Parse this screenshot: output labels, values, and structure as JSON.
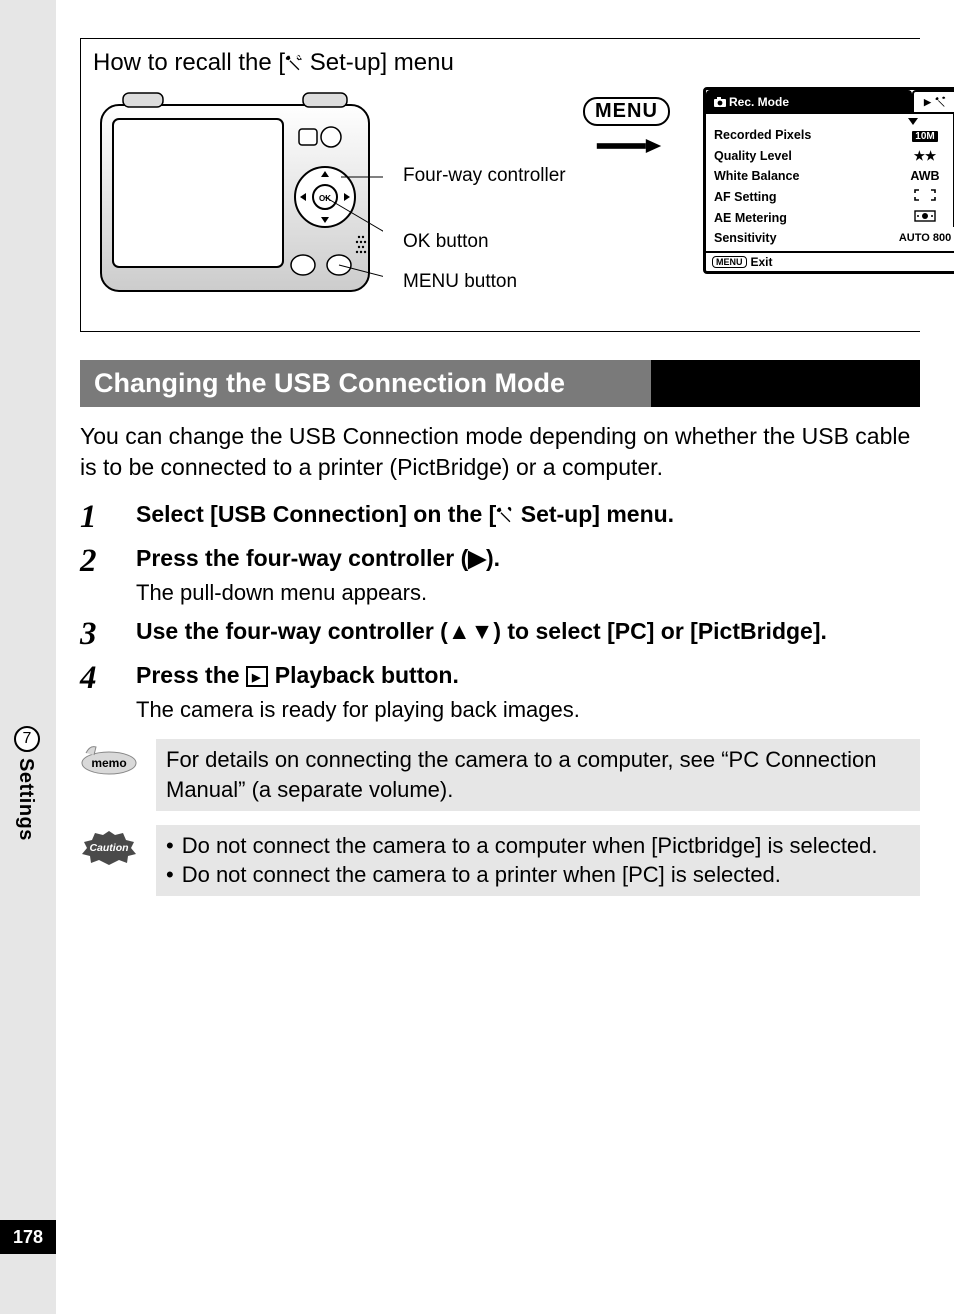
{
  "page_number": "178",
  "tab": {
    "number": "7",
    "label": "Settings"
  },
  "recall": {
    "title_pre": "How to recall the [",
    "title_post": " Set-up] menu",
    "labels": {
      "fourway": "Four-way controller",
      "ok": "OK button",
      "menu": "MENU button"
    },
    "menu_button_label": "MENU"
  },
  "menu_screen": {
    "active_tab_label": "Rec. Mode",
    "rows": [
      {
        "label": "Recorded Pixels",
        "value_type": "px",
        "value": "10M"
      },
      {
        "label": "Quality Level",
        "value_type": "stars",
        "value": "★★"
      },
      {
        "label": "White Balance",
        "value_type": "text",
        "value": "AWB"
      },
      {
        "label": "AF Setting",
        "value_type": "afframe",
        "value": ""
      },
      {
        "label": "AE Metering",
        "value_type": "meter",
        "value": ""
      },
      {
        "label": "Sensitivity",
        "value_type": "text",
        "value": "AUTO 800"
      }
    ],
    "footer": "Exit",
    "footer_btn": "MENU"
  },
  "section_heading": "Changing the USB Connection Mode",
  "intro": "You can change the USB Connection mode depending on whether the USB cable is to be connected to a printer (PictBridge) or a computer.",
  "steps": [
    {
      "num": "1",
      "title_pre": "Select [USB Connection] on the [",
      "title_post": " Set-up] menu.",
      "desc": ""
    },
    {
      "num": "2",
      "title": "Press the four-way controller (▶).",
      "desc": "The pull-down menu appears."
    },
    {
      "num": "3",
      "title": "Use the four-way controller (▲▼) to select [PC] or [PictBridge].",
      "desc": ""
    },
    {
      "num": "4",
      "title_pre": "Press the ",
      "title_post": " Playback button.",
      "desc": "The camera is ready for playing back images."
    }
  ],
  "memo": "For details on connecting the camera to a computer, see “PC Connection Manual” (a separate volume).",
  "memo_label": "memo",
  "caution_label": "Caution",
  "caution": [
    "Do not connect the camera to a computer when [Pictbridge] is selected.",
    "Do not connect the camera to a printer when [PC] is selected."
  ]
}
